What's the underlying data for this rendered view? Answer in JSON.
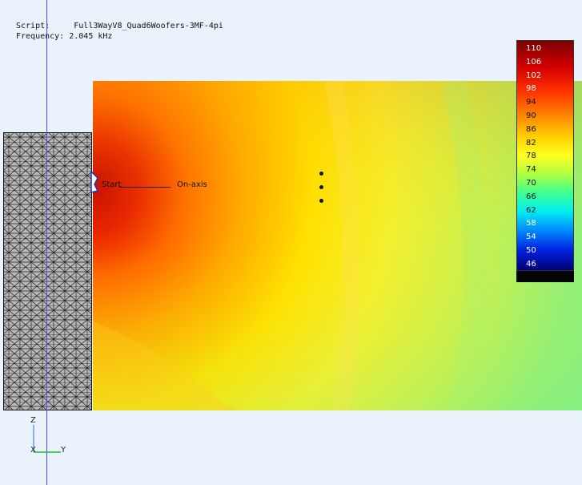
{
  "header": {
    "script_label": "Script:",
    "script_value": "Full3WayV8_Quad6Woofers-3MF-4pi",
    "frequency_label": "Frequency:",
    "frequency_value": "2.045 kHz"
  },
  "markers": {
    "start_label": "Start",
    "on_axis_label": "On-axis"
  },
  "axes": {
    "z": "Z",
    "x": "X",
    "y": "Y"
  },
  "color_scale": {
    "labels": [
      "110",
      "106",
      "102",
      "98",
      "94",
      "90",
      "86",
      "82",
      "78",
      "74",
      "70",
      "66",
      "62",
      "58",
      "54",
      "50",
      "46"
    ],
    "label_colors": [
      "#ffffff",
      "#ffffff",
      "#ffffff",
      "#ffffff",
      "#111111",
      "#111111",
      "#111111",
      "#111111",
      "#111111",
      "#111111",
      "#111111",
      "#111111",
      "#111111",
      "#ffffff",
      "#ffffff",
      "#ffffff",
      "#ffffff"
    ]
  },
  "colors": {
    "background": "#eaf2fb",
    "cursor_line": "#4a4aff",
    "field_near": "#d40000",
    "field_mid": "#ffe000",
    "field_far": "#7ff08a"
  }
}
